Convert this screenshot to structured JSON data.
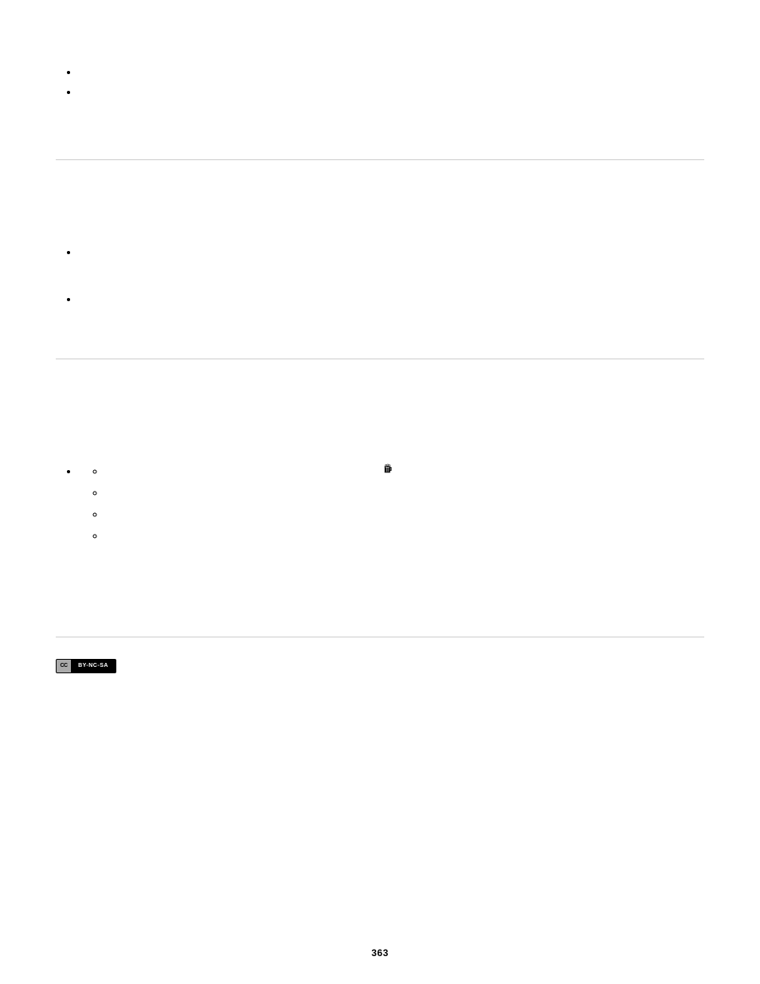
{
  "topList": [
    "",
    ""
  ],
  "midList": [
    {
      "text": ""
    },
    {
      "text": ""
    }
  ],
  "bottom": {
    "outer": [
      ""
    ],
    "inner": [
      {
        "before": "",
        "hasIcon": true,
        "after": ""
      },
      {
        "before": "",
        "hasIcon": false
      },
      {
        "before": "",
        "hasIcon": false
      },
      {
        "before": "",
        "hasIcon": false
      }
    ]
  },
  "ccLabel": "CC",
  "ccText": "BY-NC-SA",
  "pageNumber": "363"
}
